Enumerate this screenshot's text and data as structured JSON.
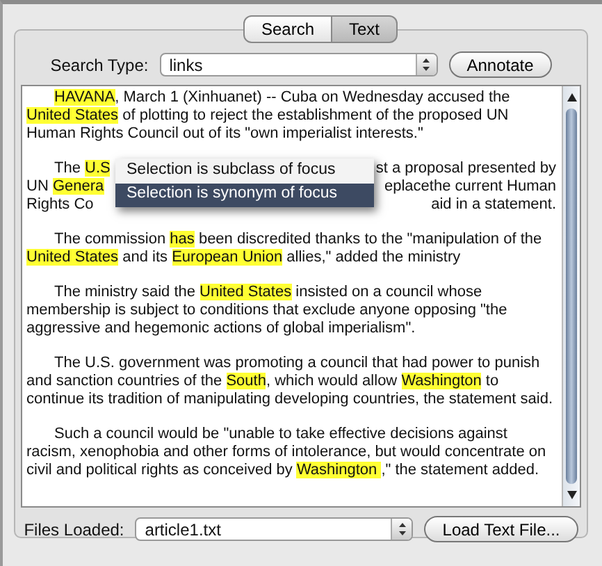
{
  "tabs": [
    {
      "label": "Search",
      "selected": false
    },
    {
      "label": "Text",
      "selected": true
    }
  ],
  "search_type": {
    "label": "Search Type:",
    "value": "links"
  },
  "annotate_button": "Annotate",
  "document": {
    "paragraphs": [
      {
        "kind": "flow",
        "segments": [
          {
            "text": "HAVANA",
            "highlighted": true
          },
          {
            "text": ", March 1 (Xinhuanet) -- Cuba on Wednesday accused the ",
            "highlighted": false
          },
          {
            "text": "United States",
            "highlighted": true
          },
          {
            "text": " of plotting to reject the establishment of the proposed UN Human Rights Council out of its \"own imperialist interests.\"",
            "highlighted": false
          }
        ]
      },
      {
        "kind": "covered",
        "lines": [
          {
            "left": [
              {
                "text": "The ",
                "highlighted": false
              },
              {
                "text": "U.S",
                "highlighted": true
              }
            ],
            "right": "st a proposal presented by"
          },
          {
            "left": [
              {
                "text": "UN ",
                "highlighted": false
              },
              {
                "text": "Genera",
                "highlighted": true
              }
            ],
            "right": "eplacethe current Human"
          },
          {
            "left": [
              {
                "text": "Rights Co",
                "highlighted": false
              }
            ],
            "right": "aid in a statement."
          }
        ]
      },
      {
        "kind": "flow",
        "segments": [
          {
            "text": "The commission ",
            "highlighted": false
          },
          {
            "text": "has",
            "highlighted": true
          },
          {
            "text": " been discredited thanks to the \"manipulation of the ",
            "highlighted": false
          },
          {
            "text": "United States",
            "highlighted": true
          },
          {
            "text": " and its ",
            "highlighted": false
          },
          {
            "text": "European Union",
            "highlighted": true
          },
          {
            "text": " allies,\" added the ministry",
            "highlighted": false
          }
        ]
      },
      {
        "kind": "flow",
        "segments": [
          {
            "text": "The ministry said the ",
            "highlighted": false
          },
          {
            "text": "United States",
            "highlighted": true
          },
          {
            "text": " insisted on a council whose membership is subject to conditions that exclude anyone opposing \"the aggressive and hegemonic actions of global imperialism\".",
            "highlighted": false
          }
        ]
      },
      {
        "kind": "flow",
        "segments": [
          {
            "text": "The U.S. government was promoting a council that had power to punish and sanction countries of the ",
            "highlighted": false
          },
          {
            "text": "South",
            "highlighted": true
          },
          {
            "text": ", which would allow ",
            "highlighted": false
          },
          {
            "text": "Washington",
            "highlighted": true
          },
          {
            "text": " to continue its tradition of manipulating developing countries, the statement said.",
            "highlighted": false
          }
        ]
      },
      {
        "kind": "flow",
        "segments": [
          {
            "text": "Such a council would be \"unable to take effective decisions against racism, xenophobia and other forms of intolerance, but would concentrate on civil and political rights as conceived by ",
            "highlighted": false
          },
          {
            "text": "Washington ",
            "highlighted": true
          },
          {
            "text": ",\" the statement added.",
            "highlighted": false
          }
        ]
      }
    ]
  },
  "context_menu": {
    "items": [
      {
        "label": "Selection is subclass of focus",
        "selected": false
      },
      {
        "label": "Selection is synonym of focus",
        "selected": true
      }
    ]
  },
  "files_loaded": {
    "label": "Files Loaded:",
    "value": "article1.txt"
  },
  "load_button": "Load Text File..."
}
